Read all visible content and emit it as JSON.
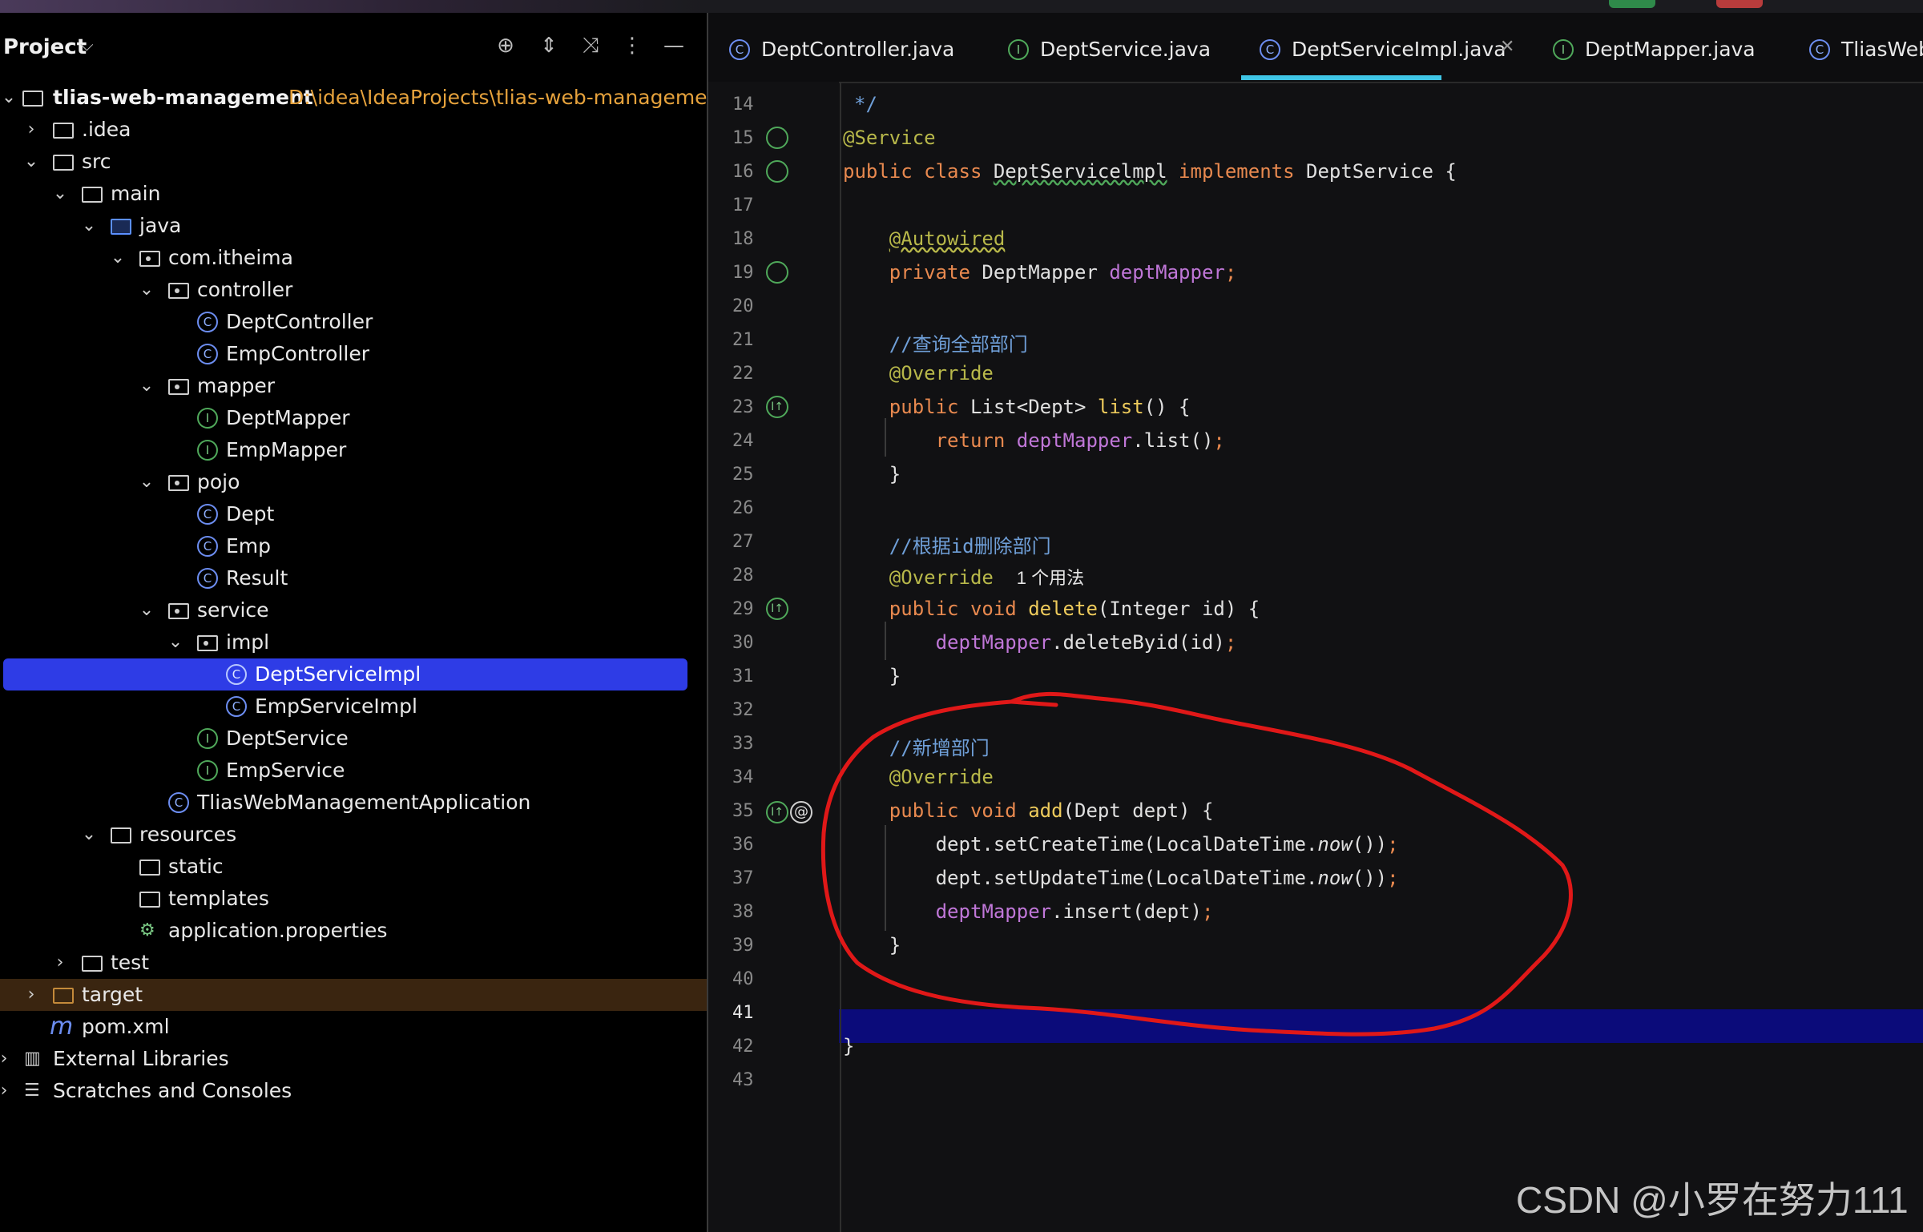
{
  "project_panel": {
    "title": "Project",
    "root": {
      "name": "tlias-web-management",
      "path": "D:\\idea\\IdeaProjects\\tlias-web-management"
    },
    "tree": [
      ".idea",
      "src",
      "main",
      "java",
      "com.itheima",
      "controller",
      "DeptController",
      "EmpController",
      "mapper",
      "DeptMapper",
      "EmpMapper",
      "pojo",
      "Dept",
      "Emp",
      "Result",
      "service",
      "impl",
      "DeptServiceImpl",
      "EmpServiceImpl",
      "DeptService",
      "EmpService",
      "TliasWebManagementApplication",
      "resources",
      "static",
      "templates",
      "application.properties",
      "test",
      "target",
      "pom.xml",
      "External Libraries",
      "Scratches and Consoles"
    ],
    "selected_item": "DeptServiceImpl",
    "colors": {
      "selected": "#2e3ce6",
      "path": "#e6a23c"
    }
  },
  "tabs": [
    {
      "label": "DeptController.java",
      "icon": "class-icon"
    },
    {
      "label": "DeptService.java",
      "icon": "interface-icon"
    },
    {
      "label": "DeptServiceImpl.java",
      "icon": "class-icon",
      "active": true
    },
    {
      "label": "DeptMapper.java",
      "icon": "interface-icon"
    },
    {
      "label": "TliasWeb",
      "icon": "app-class-icon"
    }
  ],
  "editor": {
    "line_numbers": [
      "14",
      "15",
      "16",
      "17",
      "18",
      "19",
      "20",
      "21",
      "22",
      "23",
      "24",
      "25",
      "26",
      "27",
      "28",
      "29",
      "30",
      "31",
      "32",
      "33",
      "34",
      "35",
      "36",
      "37",
      "38",
      "39",
      "40",
      "41",
      "42",
      "43"
    ],
    "current_line": "41",
    "tokens": {
      "l14": "*/",
      "l15": "@Service",
      "l16_kw": "public class",
      "l16_name": "DeptServicelmpl",
      "l16_impl": "implements",
      "l16_rest": "DeptService {",
      "l18": "@Autowired",
      "l19_kw": "private",
      "l19_type": "DeptMapper",
      "l19_field": "deptMapper",
      "l19_end": ";",
      "l21": "//查询全部部门",
      "l22": "@Override",
      "l23_kw": "public",
      "l23_type": "List<Dept>",
      "l23_fn": "list",
      "l23_end": "() {",
      "l24_kw": "return",
      "l24_field": "deptMapper",
      "l24_rest": ".list()",
      "l24_semi": ";",
      "l25": "}",
      "l27": "//根据id删除部门",
      "l28": "@Override",
      "l28_usage": "1 个用法",
      "l29_kw": "public void",
      "l29_fn": "delete",
      "l29_rest": "(Integer id) {",
      "l30_field": "deptMapper",
      "l30_rest": ".deleteByid(id)",
      "l30_semi": ";",
      "l31": "}",
      "l33": "//新增部门",
      "l34": "@Override",
      "l35_kw": "public void",
      "l35_fn": "add",
      "l35_rest": "(Dept dept) {",
      "l36_a": "dept.setCreateTime(LocalDateTime.",
      "l36_now": "now",
      "l36_b": "())",
      "l36_semi": ";",
      "l37_a": "dept.setUpdateTime(LocalDateTime.",
      "l37_now": "now",
      "l37_b": "())",
      "l37_semi": ";",
      "l38_field": "deptMapper",
      "l38_rest": ".insert(dept)",
      "l38_semi": ";",
      "l39": "}",
      "l42": "}"
    }
  },
  "watermark": "CSDN @小罗在努力111",
  "colors": {
    "keyword": "#e8894f",
    "annotation": "#b8b84a",
    "comment": "#6f9fd8",
    "field": "#c077d8",
    "function": "#eecb5c",
    "annotation_ink": "#e01818",
    "current_line": "#0b0b7a",
    "active_tab": "#3fc6e6"
  }
}
